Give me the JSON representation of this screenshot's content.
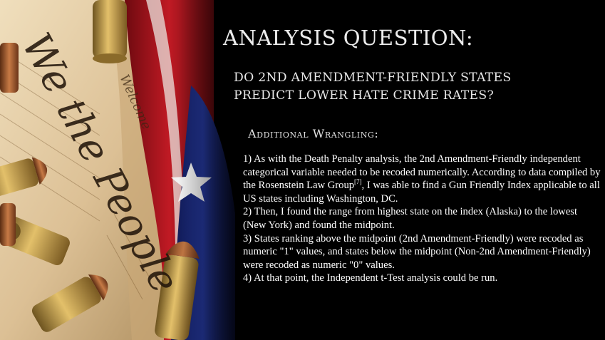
{
  "slide": {
    "title": "ANALYSIS QUESTION:",
    "question_lines": [
      "DO 2ND AMENDMENT-FRIENDLY STATES",
      "PREDICT LOWER HATE CRIME RATES?"
    ],
    "subheading": "Additional Wrangling:",
    "paragraphs": {
      "p1_part1": "1) As with the Death Penalty analysis, the 2nd Amendment-Friendly independent categorical variable needed to be recoded numerically. According to data compiled by the Rosenstein Law Group",
      "p1_citation": "[7]",
      "p1_part2": ", I was able to find a Gun Friendly Index applicable to all US states including Washington, DC.",
      "p2": "2) Then, I found the range from highest state on the index (Alaska) to the lowest (New York) and found the midpoint.",
      "p3": "3) States ranking above the midpoint (2nd Amendment-Friendly) were recoded as numeric \"1\" values, and states below the midpoint (Non-2nd Amendment-Friendly) were recoded as numeric \"0\" values.",
      "p4": "4) At that point, the Independent t-Test analysis could be run."
    },
    "image_text": {
      "preamble_heading": "We the People",
      "preamble_side": "Welcome"
    }
  },
  "colors": {
    "background": "#000000",
    "title_text": "#ececec",
    "body_text": "#ffffff",
    "parchment": "#e7d2ad",
    "flag_red": "#a5121c",
    "flag_blue": "#1b2a7a",
    "brass": "#c8a14c",
    "copper": "#a75a2c"
  }
}
